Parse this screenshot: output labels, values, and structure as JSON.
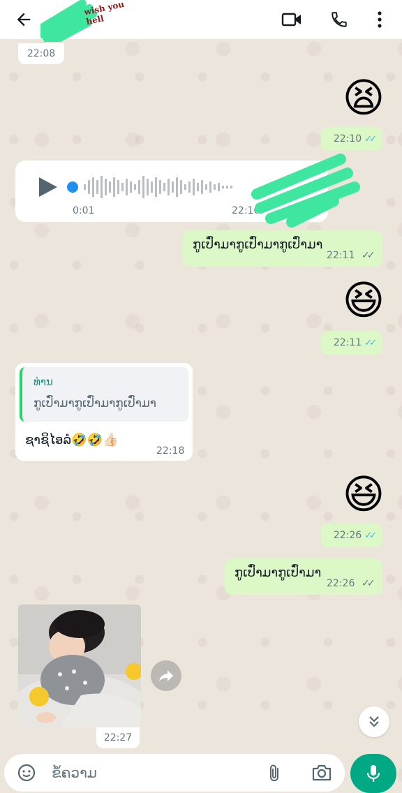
{
  "header": {
    "contact_name": "wish you hell",
    "icons": [
      "back-arrow-icon",
      "video-call-icon",
      "voice-call-icon",
      "more-menu-icon"
    ]
  },
  "chat": {
    "top_time": "22:08",
    "messages": [
      {
        "type": "emoji",
        "direction": "out",
        "emoji": "😫",
        "time": "22:10",
        "ticks": "✓✓"
      },
      {
        "type": "voice",
        "direction": "in",
        "duration": "0:01",
        "time": "22:10"
      },
      {
        "type": "text",
        "direction": "out",
        "text": "ກູເປົ່າມາກູເປົ່າມາກູເປົ່າມາ",
        "time": "22:11",
        "ticks": "✓✓"
      },
      {
        "type": "emoji",
        "direction": "out",
        "emoji": "😆",
        "time": "22:11",
        "ticks": "✓✓"
      },
      {
        "type": "reply",
        "direction": "in",
        "quote_author": "ທ່ານ",
        "quote_text": "ກູເປົ່າມາກູເປົ່າມາກູເປົ່າມາ",
        "text": "ຊາຊິໄອລໍ🤣🤣👍🏻",
        "time": "22:18"
      },
      {
        "type": "emoji",
        "direction": "out",
        "emoji": "😆",
        "time": "22:26",
        "ticks": "✓✓"
      },
      {
        "type": "text",
        "direction": "out",
        "text": "ກູເປົ່າມາກູເປົ່າມາ",
        "time": "22:26",
        "ticks": "✓✓"
      },
      {
        "type": "image",
        "direction": "in",
        "time": "22:27"
      }
    ]
  },
  "composer": {
    "placeholder": "ຂໍ້ຄວາມ"
  },
  "colors": {
    "outgoing_bubble": "#dcf8c6",
    "incoming_bubble": "#ffffff",
    "accent": "#00a884",
    "ticks": "#34b7f1"
  }
}
